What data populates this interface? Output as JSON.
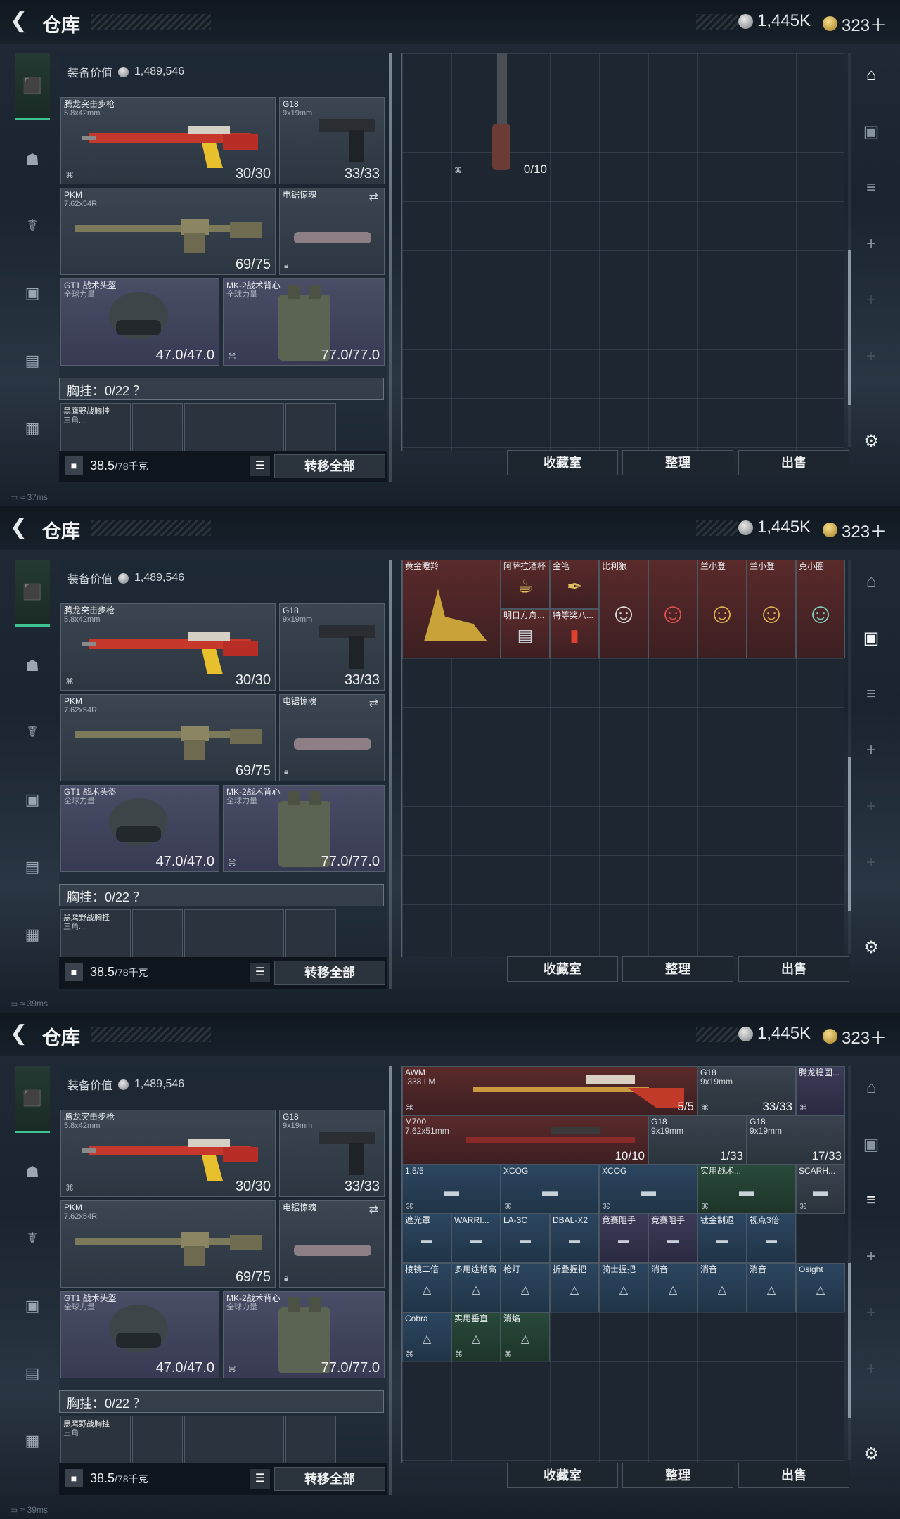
{
  "title": "仓库",
  "currency": {
    "silver": "1,445K",
    "gold": "323＋"
  },
  "equip_value_label": "装备价值",
  "equip_value": "1,489,546",
  "slots": {
    "rifle": {
      "name": "腾龙突击步枪",
      "sub": "5.8x42mm",
      "count": "30/30"
    },
    "pistol": {
      "name": "G18",
      "sub": "9x19mm",
      "count": "33/33"
    },
    "mg": {
      "name": "PKM",
      "sub": "7.62x54R",
      "count": "69/75"
    },
    "melee": {
      "name": "电锯惊魂"
    },
    "helmet": {
      "name": "GT1 战术头盔",
      "sub": "全球力量",
      "count": "47.0/47.0"
    },
    "vest": {
      "name": "MK-2战术背心",
      "sub": "全球力量",
      "count": "77.0/77.0"
    }
  },
  "chest_label": "胸挂：0/22 ？",
  "rig_item": {
    "name": "黑鹰野战胸挂",
    "sub": "三角..."
  },
  "weight": {
    "value": "38.5",
    "max": "/78千克"
  },
  "transfer_all": "转移全部",
  "stash_buttons": {
    "collection": "收藏室",
    "sort": "整理",
    "sell": "出售"
  },
  "panels": [
    {
      "ping": "37ms"
    },
    {
      "ping": "39ms"
    },
    {
      "ping": "39ms"
    }
  ],
  "panel1_items": [
    {
      "count": "0/10"
    }
  ],
  "panel2_items": [
    {
      "name": "黄金瞪羚"
    },
    {
      "name": "阿萨拉酒杯"
    },
    {
      "name": "金笔"
    },
    {
      "name": "比利狼"
    },
    {
      "name": ""
    },
    {
      "name": "兰小登"
    },
    {
      "name": "兰小登"
    },
    {
      "name": "克小圈"
    },
    {
      "name": "明日方舟..."
    },
    {
      "name": "特等奖八..."
    }
  ],
  "panel3_items": {
    "awm": {
      "name": "AWM",
      "sub": ".338 LM",
      "count": "5/5"
    },
    "g18a": {
      "name": "G18",
      "sub": "9x19mm",
      "count": "33/33"
    },
    "grip": {
      "name": "腾龙稳固..."
    },
    "m700": {
      "name": "M700",
      "sub": "7.62x51mm",
      "count": "10/10"
    },
    "g18b": {
      "name": "G18",
      "sub": "9x19mm",
      "count": "1/33"
    },
    "g18c": {
      "name": "G18",
      "sub": "9x19mm",
      "count": "17/33"
    },
    "row3": [
      "1.5/5",
      "XCOG",
      "XCOG",
      "实用战术...",
      "SCARH..."
    ],
    "row4": [
      "遮光罩",
      "WARRI...",
      "LA-3C",
      "DBAL-X2",
      "竞赛阻手",
      "竞赛阻手",
      "钛金制退",
      "视点3倍"
    ],
    "row5": [
      "棱镜二倍",
      "多用途增高",
      "枪灯",
      "折叠握把",
      "骑士握把",
      "消音",
      "消音",
      "消音",
      "Osight"
    ],
    "row6": [
      "Cobra",
      "实用垂直",
      "消焰"
    ]
  }
}
